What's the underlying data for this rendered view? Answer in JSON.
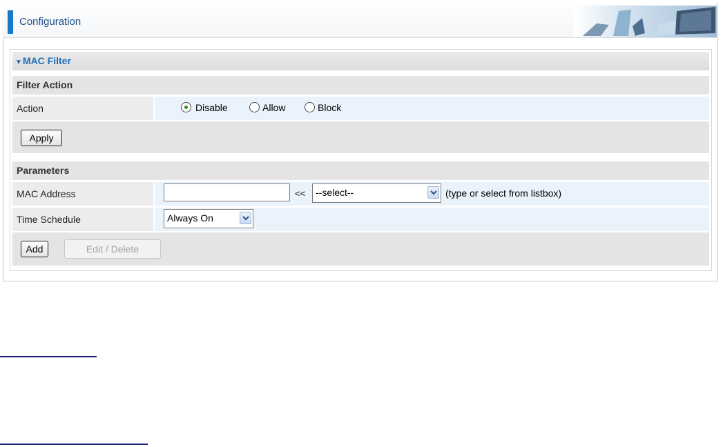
{
  "header": {
    "title": "Configuration"
  },
  "mac_filter": {
    "title": "MAC Filter"
  },
  "filter_action": {
    "section_title": "Filter Action",
    "action_label": "Action",
    "options": [
      {
        "label": "Disable",
        "selected": true
      },
      {
        "label": "Allow",
        "selected": false
      },
      {
        "label": "Block",
        "selected": false
      }
    ],
    "apply_label": "Apply"
  },
  "parameters": {
    "section_title": "Parameters",
    "mac_label": "MAC Address",
    "mac_value": "",
    "arrows": "<<",
    "mac_select_value": "--select--",
    "mac_hint": "(type or select from listbox)",
    "schedule_label": "Time Schedule",
    "schedule_value": "Always On",
    "add_label": "Add",
    "edit_delete_label": "Edit / Delete"
  },
  "colors": {
    "accent": "#1a78c4",
    "link_blue": "#1d6fb8",
    "value_bg": "#eaf3fc"
  }
}
